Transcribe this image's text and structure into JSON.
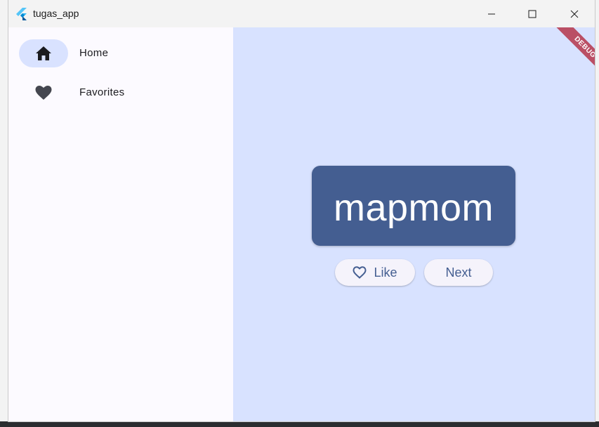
{
  "window": {
    "title": "tugas_app",
    "logo_icon": "flutter-logo"
  },
  "controls": {
    "minimize_icon": "minimize-icon",
    "maximize_icon": "maximize-icon",
    "close_icon": "close-icon"
  },
  "rail": {
    "items": [
      {
        "label": "Home",
        "icon": "home-icon",
        "selected": true
      },
      {
        "label": "Favorites",
        "icon": "heart-icon",
        "selected": false
      }
    ]
  },
  "main": {
    "word": "mapmom",
    "like_label": "Like",
    "like_icon": "heart-outline-icon",
    "next_label": "Next"
  },
  "debug": {
    "label": "DEBUG"
  },
  "colors": {
    "primary": "#445e91",
    "main_bg": "#d8e2ff",
    "rail_bg": "#fcfaff",
    "indicator": "#d9e2ff",
    "debug_ribbon": "#b01e32"
  }
}
